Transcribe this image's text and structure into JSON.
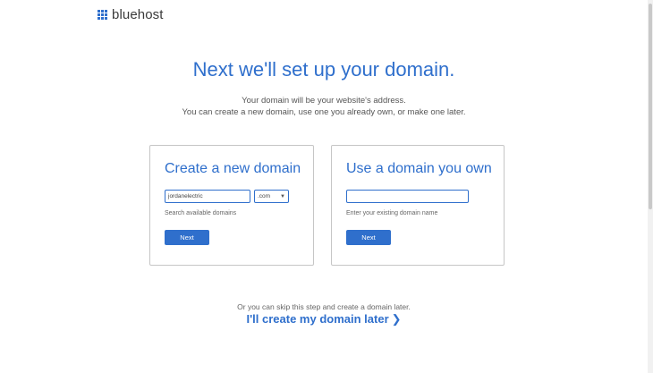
{
  "brand": {
    "name": "bluehost",
    "color": "#2f6fcc"
  },
  "page": {
    "title": "Next we'll set up your domain.",
    "subtitle_line1": "Your domain will be your website's address.",
    "subtitle_line2": "You can create a new domain, use one you already own, or make one later."
  },
  "new_domain_card": {
    "heading": "Create a new domain",
    "domain_input_value": "jordanelectric",
    "tld_selected": ".com",
    "hint": "Search available domains",
    "button_label": "Next"
  },
  "own_domain_card": {
    "heading": "Use a domain you own",
    "domain_input_value": "",
    "hint": "Enter your existing domain name",
    "button_label": "Next"
  },
  "skip": {
    "text": "Or you can skip this step and create a domain later.",
    "link_label": "I'll create my domain later",
    "link_icon": "chevron-right-icon"
  }
}
